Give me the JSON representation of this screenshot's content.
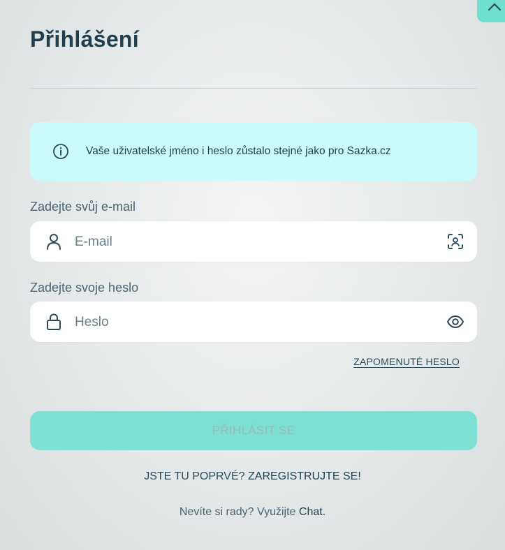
{
  "dialog": {
    "title": "Přihlášení",
    "close_icon": "close-icon"
  },
  "info": {
    "icon": "info-icon",
    "text": "Vaše uživatelské jméno i heslo zůstalo stejné jako pro Sazka.cz"
  },
  "email": {
    "label": "Zadejte svůj e-mail",
    "placeholder": "E-mail",
    "value": "",
    "lead_icon": "user-icon",
    "trail_icon": "face-scan-icon"
  },
  "password": {
    "label": "Zadejte svoje heslo",
    "placeholder": "Heslo",
    "value": "",
    "lead_icon": "lock-icon",
    "trail_icon": "eye-icon"
  },
  "forgot_password": "ZAPOMENUTÉ HESLO",
  "login_button": "PŘIHLÁSIT SE",
  "register": {
    "prompt": "JSTE TU POPRVÉ? ",
    "link": "ZAREGISTRUJTE SE!"
  },
  "help": {
    "prompt": "Nevíte si rady? Využijte ",
    "link": "Chat."
  },
  "colors": {
    "accent": "#7ee0d3",
    "info_bg": "#c8fbfa",
    "title": "#1f3f4d"
  }
}
